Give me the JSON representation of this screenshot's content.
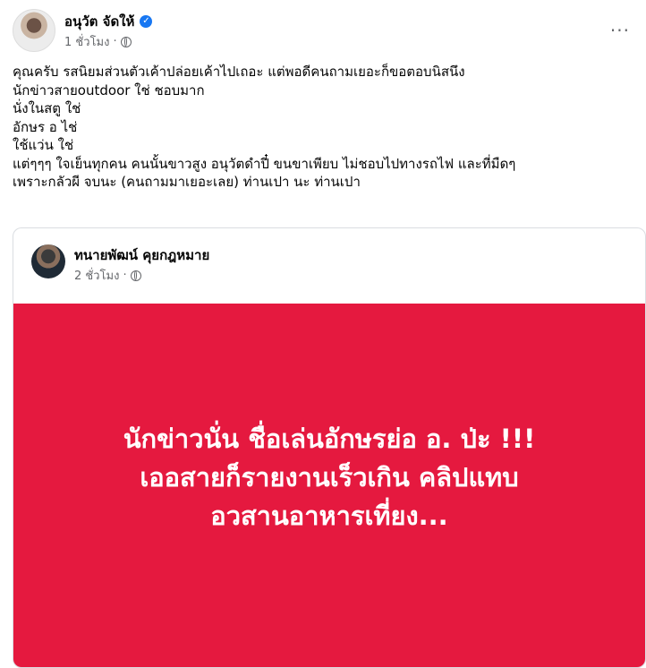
{
  "post": {
    "author": "อนุวัต จัดให้",
    "time": "1 ชั่วโมง",
    "separator": "·",
    "more_label": "···",
    "lines": [
      "คุณครับ  รสนิยมส่วนตัวเค้าปล่อยเค้าไปเถอะ  แต่พอดีคนถามเยอะก็ขอตอบนิสนึง",
      "นักข่าวสายoutdoor ใช่ ชอบมาก",
      "นั่งในสตู ใช่",
      "อักษร  อ  ไช่",
      "ใช้แว่น  ใช่",
      "แต่ๆๆๆ ใจเย็นทุกคน  คนนั้นขาวสูง อนุวัตดำปี๋  ขนขาเพียบ ไม่ชอบไปทางรถไฟ และที่มืดๆ",
      "เพราะกลัวผี  จบนะ (คนถามมาเยอะเลย) ท่านเปา นะ ท่านเปา"
    ]
  },
  "shared": {
    "author": "ทนายพัฒน์ คุยกฎหมาย",
    "time": "2 ชั่วโมง",
    "separator": "·",
    "headline_lines": [
      "นักข่าวนั่น ชื่อเล่นอักษรย่อ อ. ป่ะ !!!",
      "เออสายก็รายงานเร็วเกิน คลิปแทบ",
      "อวสานอาหารเที่ยง..."
    ]
  },
  "colors": {
    "panel": "#e5193f",
    "verified": "#1877f2"
  },
  "icons": [
    "verified-badge-icon",
    "globe-icon",
    "more-options-icon"
  ]
}
